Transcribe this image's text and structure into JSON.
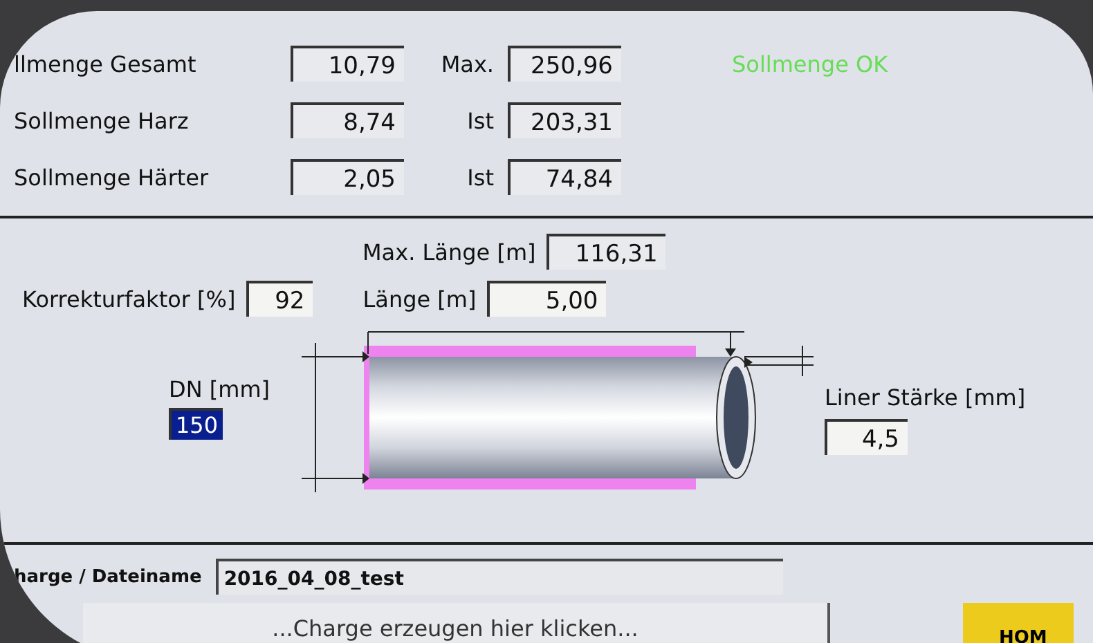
{
  "quantities": [
    {
      "label": "llmenge Gesamt",
      "value": "10,79",
      "ref_label": "Max.",
      "ref_value": "250,96"
    },
    {
      "label": "Sollmenge Harz",
      "value": "8,74",
      "ref_label": "Ist",
      "ref_value": "203,31"
    },
    {
      "label": "Sollmenge Härter",
      "value": "2,05",
      "ref_label": "Ist",
      "ref_value": "74,84"
    }
  ],
  "status": {
    "text": "Sollmenge OK",
    "ok": true
  },
  "max_length": {
    "label": "Max. Länge [m]",
    "value": "116,31"
  },
  "correction": {
    "label": "Korrekturfaktor [%]",
    "value": "92"
  },
  "length": {
    "label": "Länge [m]",
    "value": "5,00"
  },
  "dn": {
    "label": "DN [mm]",
    "value": "150",
    "highlighted": true
  },
  "liner": {
    "label": "Liner Stärke [mm]",
    "value": "4,5"
  },
  "charge": {
    "label": "harge / Dateiname",
    "value": "2016_04_08_test"
  },
  "create_button": "...Charge erzeugen hier klicken...",
  "home_button": "HOM"
}
